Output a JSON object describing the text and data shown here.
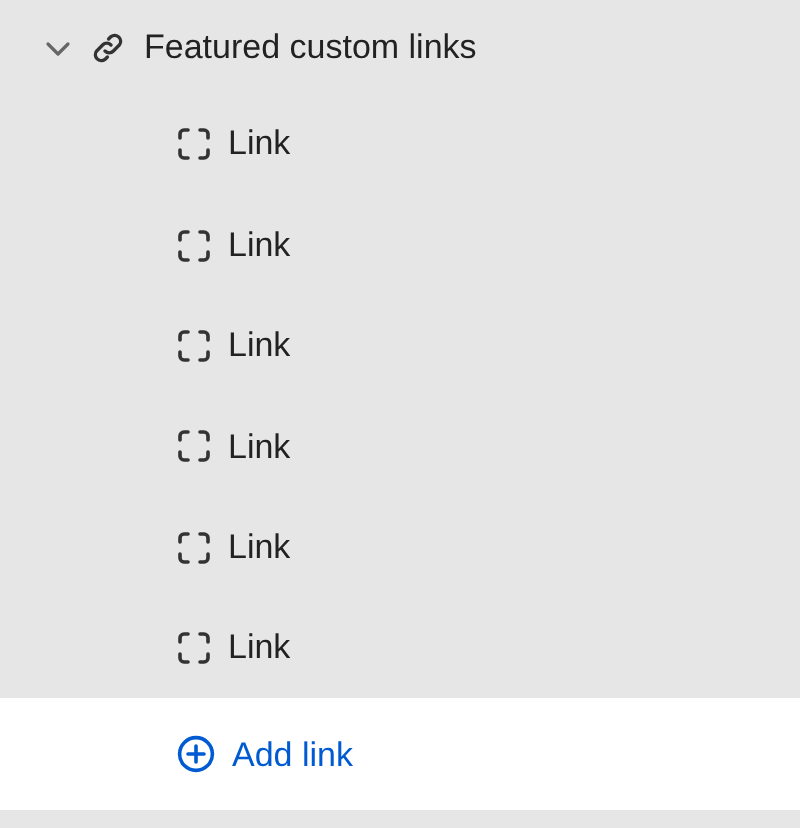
{
  "section": {
    "title": "Featured custom links",
    "expanded": true
  },
  "links": [
    {
      "label": "Link"
    },
    {
      "label": "Link"
    },
    {
      "label": "Link"
    },
    {
      "label": "Link"
    },
    {
      "label": "Link"
    },
    {
      "label": "Link"
    }
  ],
  "add_button": {
    "label": "Add link"
  }
}
